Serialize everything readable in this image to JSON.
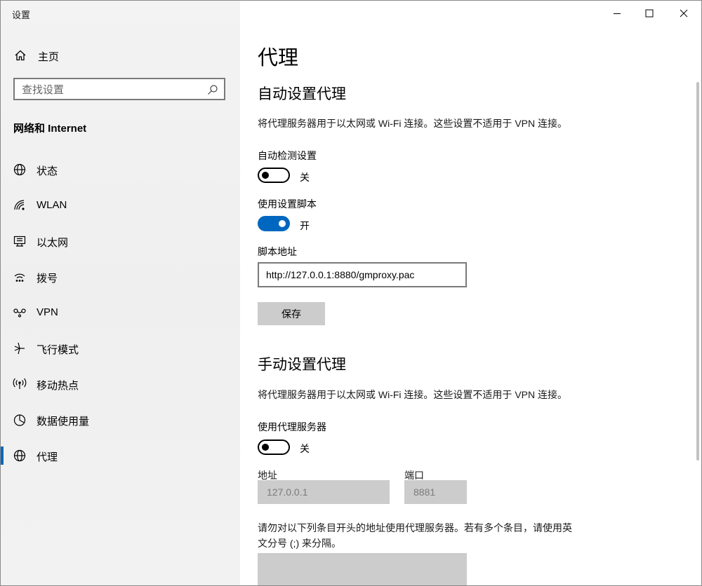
{
  "window": {
    "app_title": "设置",
    "controls": {
      "minimize": "minimize",
      "maximize": "maximize",
      "close": "close"
    }
  },
  "sidebar": {
    "home_label": "主页",
    "search": {
      "placeholder": "查找设置"
    },
    "section_title": "网络和 Internet",
    "items": [
      {
        "label": "状态",
        "icon": "globe-status-icon"
      },
      {
        "label": "WLAN",
        "icon": "wifi-icon"
      },
      {
        "label": "以太网",
        "icon": "ethernet-icon"
      },
      {
        "label": "拨号",
        "icon": "dialup-icon"
      },
      {
        "label": "VPN",
        "icon": "vpn-icon"
      },
      {
        "label": "飞行模式",
        "icon": "airplane-icon"
      },
      {
        "label": "移动热点",
        "icon": "hotspot-icon"
      },
      {
        "label": "数据使用量",
        "icon": "data-usage-icon"
      },
      {
        "label": "代理",
        "icon": "globe-icon",
        "selected": true
      }
    ]
  },
  "main": {
    "page_title": "代理",
    "auto": {
      "heading": "自动设置代理",
      "description": "将代理服务器用于以太网或 Wi-Fi 连接。这些设置不适用于 VPN 连接。",
      "detect_label": "自动检测设置",
      "detect_state": "关",
      "detect_on": false,
      "script_label": "使用设置脚本",
      "script_state": "开",
      "script_on": true,
      "address_label": "脚本地址",
      "address_value": "http://127.0.0.1:8880/gmproxy.pac",
      "save_label": "保存"
    },
    "manual": {
      "heading": "手动设置代理",
      "description": "将代理服务器用于以太网或 Wi-Fi 连接。这些设置不适用于 VPN 连接。",
      "use_proxy_label": "使用代理服务器",
      "use_proxy_state": "关",
      "use_proxy_on": false,
      "address_label": "地址",
      "address_value": "127.0.0.1",
      "port_label": "端口",
      "port_value": "8881",
      "exceptions_text_1": "请勿对以下列条目开头的地址使用代理服务器。若有多个条目，请使用英",
      "exceptions_text_2": "文分号 (;) 来分隔。",
      "exceptions_value": ""
    }
  },
  "colors": {
    "accent": "#0067c0",
    "disabled_bg": "#cccccc",
    "sidebar_bg": "#f2f2f2"
  }
}
